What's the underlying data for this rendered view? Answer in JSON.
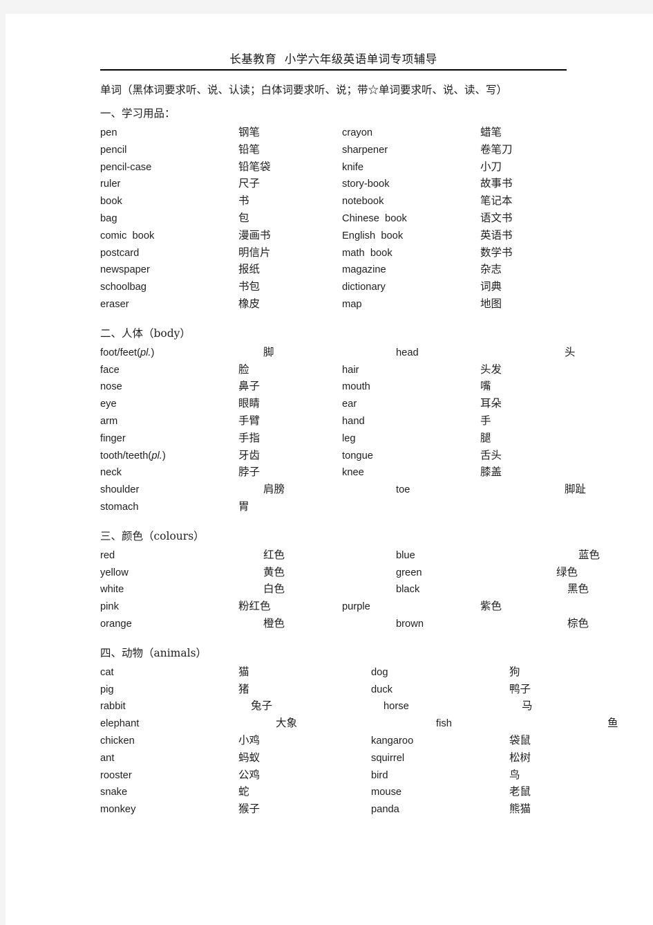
{
  "document": {
    "header_title": "长基教育  小学六年级英语单词专项辅导",
    "intro": "单词（黑体词要求听、说、认读；白体词要求听、说；带☆单词要求听、说、读、写）"
  },
  "sections": [
    {
      "heading": "一、学习用品：",
      "rows": [
        {
          "en1": "pen",
          "zh1": "钢笔",
          "en2": "crayon",
          "zh2": "蜡笔",
          "i1": 0,
          "i2": 0,
          "iz1": 0,
          "iz2": 0
        },
        {
          "en1": "pencil",
          "zh1": "铅笔",
          "en2": "sharpener",
          "zh2": "卷笔刀",
          "i1": 0,
          "i2": 0,
          "iz1": 0,
          "iz2": 0
        },
        {
          "en1": "pencil-case",
          "zh1": "铅笔袋",
          "en2": "knife",
          "zh2": "小刀",
          "i1": 0,
          "i2": 0,
          "iz1": 0,
          "iz2": 0
        },
        {
          "en1": "ruler",
          "zh1": "尺子",
          "en2": "story-book",
          "zh2": "故事书",
          "i1": 0,
          "i2": 0,
          "iz1": 0,
          "iz2": 0
        },
        {
          "en1": "book",
          "zh1": "书",
          "en2": "notebook",
          "zh2": "笔记本",
          "i1": 0,
          "i2": 0,
          "iz1": 0,
          "iz2": 0
        },
        {
          "en1": "bag",
          "zh1": "包",
          "en2": "Chinese  book",
          "zh2": "语文书",
          "i1": 0,
          "i2": 0,
          "iz1": 0,
          "iz2": 0
        },
        {
          "en1": "comic  book",
          "zh1": "漫画书",
          "en2": "English  book",
          "zh2": "英语书",
          "i1": 0,
          "i2": 0,
          "iz1": 0,
          "iz2": 0
        },
        {
          "en1": "postcard",
          "zh1": "明信片",
          "en2": "math  book",
          "zh2": "数学书",
          "i1": 0,
          "i2": 0,
          "iz1": 0,
          "iz2": 0
        },
        {
          "en1": "newspaper",
          "zh1": "报纸",
          "en2": "magazine",
          "zh2": "杂志",
          "i1": 0,
          "i2": 0,
          "iz1": 0,
          "iz2": 0
        },
        {
          "en1": "schoolbag",
          "zh1": "书包",
          "en2": "dictionary",
          "zh2": "词典",
          "i1": 0,
          "i2": 0,
          "iz1": 0,
          "iz2": 0
        },
        {
          "en1": "eraser",
          "zh1": "橡皮",
          "en2": "map",
          "zh2": "地图",
          "i1": 0,
          "i2": 0,
          "iz1": 0,
          "iz2": 0
        }
      ]
    },
    {
      "heading": "二、人体（body）",
      "rows": [
        {
          "en1": "foot/feet(pl.)",
          "zh1": "脚",
          "en2": "head",
          "zh2": "头",
          "i1": 0,
          "i2": 42,
          "iz1": 36,
          "iz2": 44,
          "italic1": "pl."
        },
        {
          "en1": "face",
          "zh1": "脸",
          "en2": "hair",
          "zh2": "头发",
          "i1": 0,
          "i2": 0,
          "iz1": 0,
          "iz2": 0
        },
        {
          "en1": "nose",
          "zh1": "鼻子",
          "en2": "mouth",
          "zh2": "嘴",
          "i1": 0,
          "i2": 0,
          "iz1": 0,
          "iz2": 0
        },
        {
          "en1": "eye",
          "zh1": "眼睛",
          "en2": "ear",
          "zh2": "耳朵",
          "i1": 0,
          "i2": 0,
          "iz1": 0,
          "iz2": 0
        },
        {
          "en1": "arm",
          "zh1": "手臂",
          "en2": "hand",
          "zh2": "手",
          "i1": 0,
          "i2": 0,
          "iz1": 0,
          "iz2": 0
        },
        {
          "en1": "finger",
          "zh1": "手指",
          "en2": "leg",
          "zh2": "腿",
          "i1": 0,
          "i2": 0,
          "iz1": 0,
          "iz2": 0
        },
        {
          "en1": "tooth/teeth(pl.)",
          "zh1": "牙齿",
          "en2": "tongue",
          "zh2": "舌头",
          "i1": 0,
          "i2": 0,
          "iz1": 0,
          "iz2": 0,
          "italic1": "pl."
        },
        {
          "en1": "neck",
          "zh1": "脖子",
          "en2": "knee",
          "zh2": "膝盖",
          "i1": 0,
          "i2": 0,
          "iz1": 0,
          "iz2": 0
        },
        {
          "en1": "shoulder",
          "zh1": "肩膀",
          "en2": "toe",
          "zh2": "脚趾",
          "i1": 0,
          "i2": 42,
          "iz1": 36,
          "iz2": 44
        },
        {
          "en1": "stomach",
          "zh1": "胃",
          "en2": "",
          "zh2": "",
          "i1": 0,
          "i2": 0,
          "iz1": 0,
          "iz2": 0
        }
      ]
    },
    {
      "heading": "三、颜色（colours）",
      "rows": [
        {
          "en1": "red",
          "zh1": "红色",
          "en2": "blue",
          "zh2": "蓝色",
          "i1": 0,
          "i2": 42,
          "iz1": 36,
          "iz2": 64
        },
        {
          "en1": "yellow",
          "zh1": "黄色",
          "en2": "green",
          "zh2": "绿色",
          "i1": 0,
          "i2": 42,
          "iz1": 36,
          "iz2": 32
        },
        {
          "en1": "white",
          "zh1": "白色",
          "en2": "black",
          "zh2": "黑色",
          "i1": 0,
          "i2": 42,
          "iz1": 36,
          "iz2": 48
        },
        {
          "en1": "pink",
          "zh1": "粉红色",
          "en2": "purple",
          "zh2": "紫色",
          "i1": 0,
          "i2": 0,
          "iz1": 0,
          "iz2": 0
        },
        {
          "en1": "orange",
          "zh1": "橙色",
          "en2": "brown",
          "zh2": "棕色",
          "i1": 0,
          "i2": 42,
          "iz1": 36,
          "iz2": 48
        }
      ]
    },
    {
      "heading": "四、动物（animals）",
      "rows": [
        {
          "en1": "cat",
          "zh1": "猫",
          "en2": "dog",
          "zh2": "狗",
          "i1": 0,
          "i2": 42,
          "iz1": 0,
          "iz2": 0
        },
        {
          "en1": "pig",
          "zh1": "猪",
          "en2": "duck",
          "zh2": "鸭子",
          "i1": 0,
          "i2": 42,
          "iz1": 0,
          "iz2": 0
        },
        {
          "en1": "rabbit",
          "zh1": "兔子",
          "en2": "horse",
          "zh2": "马",
          "i1": 0,
          "i2": 42,
          "iz1": 18,
          "iz2": 0
        },
        {
          "en1": "elephant",
          "zh1": "大象",
          "en2": "fish",
          "zh2": "鱼",
          "i1": 0,
          "i2": 82,
          "iz1": 54,
          "iz2": 48
        },
        {
          "en1": "chicken",
          "zh1": "小鸡",
          "en2": "kangaroo",
          "zh2": "袋鼠",
          "i1": 0,
          "i2": 42,
          "iz1": 0,
          "iz2": 0
        },
        {
          "en1": "ant",
          "zh1": "蚂蚁",
          "en2": "squirrel",
          "zh2": "松树",
          "i1": 0,
          "i2": 42,
          "iz1": 0,
          "iz2": 0
        },
        {
          "en1": "rooster",
          "zh1": "公鸡",
          "en2": "bird",
          "zh2": "鸟",
          "i1": 0,
          "i2": 42,
          "iz1": 0,
          "iz2": 0
        },
        {
          "en1": "snake",
          "zh1": "蛇",
          "en2": "mouse",
          "zh2": "老鼠",
          "i1": 0,
          "i2": 42,
          "iz1": 0,
          "iz2": 0
        },
        {
          "en1": "monkey",
          "zh1": "猴子",
          "en2": "panda",
          "zh2": "熊猫",
          "i1": 0,
          "i2": 42,
          "iz1": 0,
          "iz2": 0
        }
      ]
    }
  ]
}
